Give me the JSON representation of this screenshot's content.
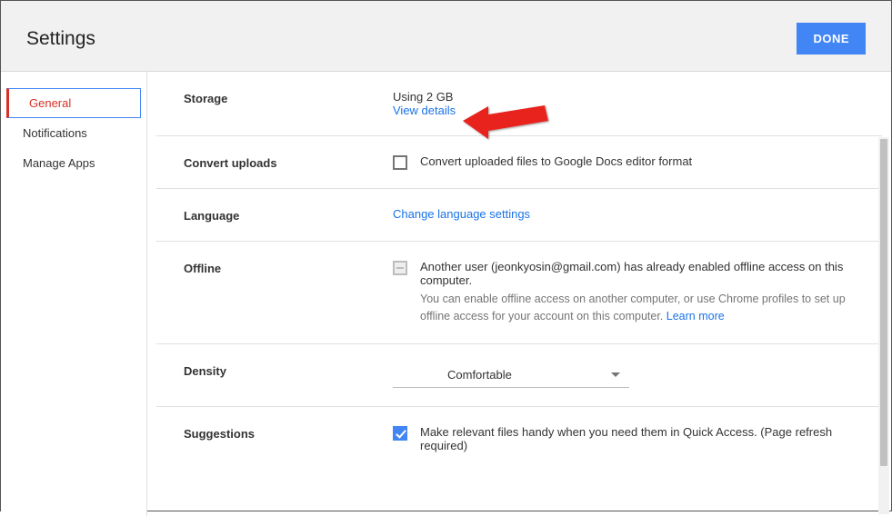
{
  "header": {
    "title": "Settings",
    "done_label": "DONE"
  },
  "sidebar": {
    "items": [
      {
        "label": "General",
        "active": true
      },
      {
        "label": "Notifications",
        "active": false
      },
      {
        "label": "Manage Apps",
        "active": false
      }
    ]
  },
  "sections": {
    "storage": {
      "label": "Storage",
      "usage": "Using 2 GB",
      "view_details": "View details"
    },
    "convert": {
      "label": "Convert uploads",
      "text": "Convert uploaded files to Google Docs editor format"
    },
    "language": {
      "label": "Language",
      "link": "Change language settings"
    },
    "offline": {
      "label": "Offline",
      "text": "Another user (jeonkyosin@gmail.com) has already enabled offline access on this computer.",
      "helper": "You can enable offline access on another computer, or use Chrome profiles to set up offline access for your account on this computer.",
      "learn_more": "Learn more"
    },
    "density": {
      "label": "Density",
      "value": "Comfortable"
    },
    "suggestions": {
      "label": "Suggestions",
      "text": "Make relevant files handy when you need them in Quick Access. (Page refresh required)"
    }
  }
}
